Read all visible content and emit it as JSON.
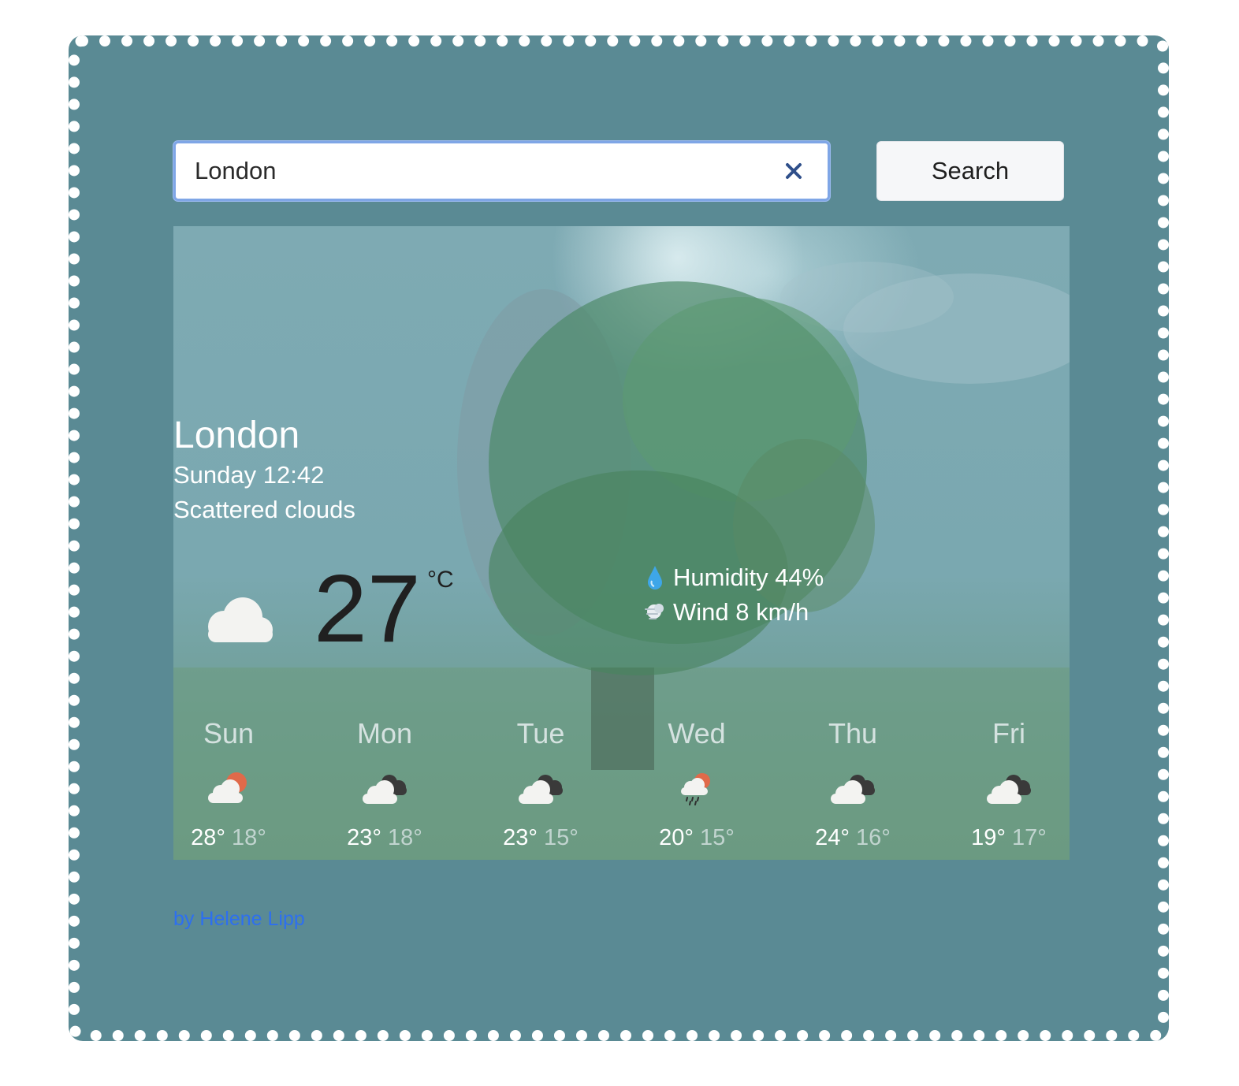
{
  "search": {
    "value": "London",
    "button_label": "Search"
  },
  "current": {
    "city": "London",
    "datetime": "Sunday 12:42",
    "condition": "Scattered clouds",
    "temperature": "27",
    "unit": "°C",
    "icon": "cloud-icon",
    "humidity": "Humidity 44%",
    "wind": "Wind 8 km/h"
  },
  "forecast": [
    {
      "day": "Sun",
      "max": "28°",
      "min": "18°",
      "icon": "partly-sunny-icon"
    },
    {
      "day": "Mon",
      "max": "23°",
      "min": "18°",
      "icon": "dark-clouds-icon"
    },
    {
      "day": "Tue",
      "max": "23°",
      "min": "15°",
      "icon": "dark-clouds-icon"
    },
    {
      "day": "Wed",
      "max": "20°",
      "min": "15°",
      "icon": "rain-sun-icon"
    },
    {
      "day": "Thu",
      "max": "24°",
      "min": "16°",
      "icon": "dark-clouds-icon"
    },
    {
      "day": "Fri",
      "max": "19°",
      "min": "17°",
      "icon": "dark-clouds-icon"
    }
  ],
  "footer": {
    "credit": "by Helene Lipp"
  },
  "colors": {
    "frame_background": "#5a8a94",
    "link": "#2d6ff0",
    "temperature_text": "#202020"
  }
}
